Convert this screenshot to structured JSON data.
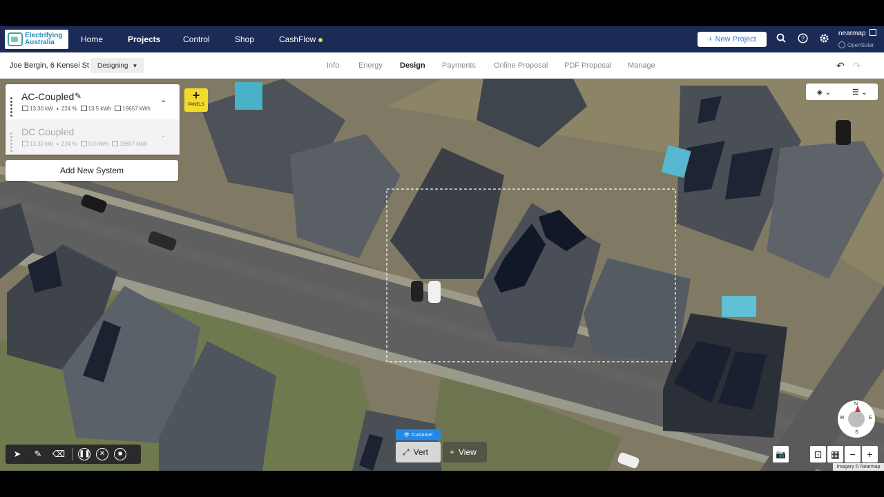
{
  "app": {
    "logo_text_line1": "Electrifying",
    "logo_text_line2": "Australia"
  },
  "topnav": {
    "items": [
      {
        "label": "Home"
      },
      {
        "label": "Projects"
      },
      {
        "label": "Control"
      },
      {
        "label": "Shop"
      },
      {
        "label": "CashFlow"
      }
    ],
    "new_project_label": "New Project",
    "nearmap_label": "nearmap",
    "opensolar_label": "OpenSolar"
  },
  "subbar": {
    "customer": "Joe Bergin, 6 Kensei St",
    "status": "Designing",
    "tabs": [
      {
        "label": "Info"
      },
      {
        "label": "Energy"
      },
      {
        "label": "Design"
      },
      {
        "label": "Payments"
      },
      {
        "label": "Online Proposal"
      },
      {
        "label": "PDF Proposal"
      },
      {
        "label": "Manage"
      }
    ],
    "active_tab": "Design"
  },
  "systems": [
    {
      "name": "AC-Coupled",
      "kw": "13.30 kW",
      "offset": "224 %",
      "battery": "13.5 kWh",
      "energy": "19657 kWh"
    },
    {
      "name": "DC Coupled",
      "kw": "13.30 kW",
      "offset": "224 %",
      "battery": "0.0 kWh",
      "energy": "19657 kWh"
    }
  ],
  "panels_button_label": "PANELS",
  "add_system_label": "Add New System",
  "view_toggle": {
    "badge": "Customer",
    "vert_label": "Vert",
    "view_label": "View"
  },
  "compass": {
    "n": "N",
    "s": "S",
    "e": "E",
    "w": "W"
  },
  "imagery_credit": "Imagery © Nearmap",
  "colors": {
    "nav_bg": "#1b2b55",
    "accent": "#3c74d6",
    "panels_yellow": "#f2dc2a",
    "badge_blue": "#2389e6"
  }
}
